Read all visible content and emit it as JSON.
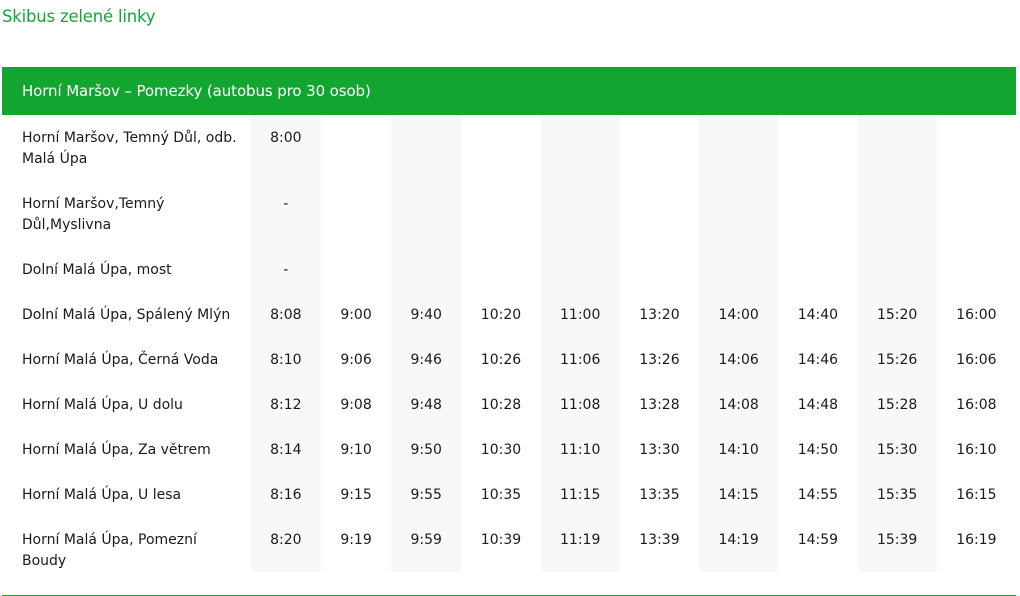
{
  "page_title": "Skibus zelené linky",
  "route_title": "Horní Maršov – Pomezky (autobus pro 30 osob)",
  "rows": [
    {
      "stop": "Horní Maršov, Temný Důl, odb. Malá Úpa",
      "times": [
        "8:00",
        "",
        "",
        "",
        "",
        "",
        "",
        "",
        "",
        ""
      ]
    },
    {
      "stop": "Horní Maršov,Temný Důl,Myslivna",
      "times": [
        "-",
        "",
        "",
        "",
        "",
        "",
        "",
        "",
        "",
        ""
      ]
    },
    {
      "stop": "Dolní Malá Úpa, most",
      "times": [
        "-",
        "",
        "",
        "",
        "",
        "",
        "",
        "",
        "",
        ""
      ]
    },
    {
      "stop": "Dolní Malá Úpa, Spálený Mlýn",
      "times": [
        "8:08",
        "9:00",
        "9:40",
        "10:20",
        "11:00",
        "13:20",
        "14:00",
        "14:40",
        "15:20",
        "16:00"
      ]
    },
    {
      "stop": "Horní Malá Úpa, Černá Voda",
      "times": [
        "8:10",
        "9:06",
        "9:46",
        "10:26",
        "11:06",
        "13:26",
        "14:06",
        "14:46",
        "15:26",
        "16:06"
      ]
    },
    {
      "stop": "Horní Malá Úpa, U dolu",
      "times": [
        "8:12",
        "9:08",
        "9:48",
        "10:28",
        "11:08",
        "13:28",
        "14:08",
        "14:48",
        "15:28",
        "16:08"
      ]
    },
    {
      "stop": "Horní Malá Úpa, Za větrem",
      "times": [
        "8:14",
        "9:10",
        "9:50",
        "10:30",
        "11:10",
        "13:30",
        "14:10",
        "14:50",
        "15:30",
        "16:10"
      ]
    },
    {
      "stop": "Horní Malá Úpa, U lesa",
      "times": [
        "8:16",
        "9:15",
        "9:55",
        "10:35",
        "11:15",
        "13:35",
        "14:15",
        "14:55",
        "15:35",
        "16:15"
      ]
    },
    {
      "stop": "Horní Malá Úpa, Pomezní Boudy",
      "times": [
        "8:20",
        "9:19",
        "9:59",
        "10:39",
        "11:19",
        "13:39",
        "14:19",
        "14:59",
        "15:39",
        "16:19"
      ]
    }
  ]
}
